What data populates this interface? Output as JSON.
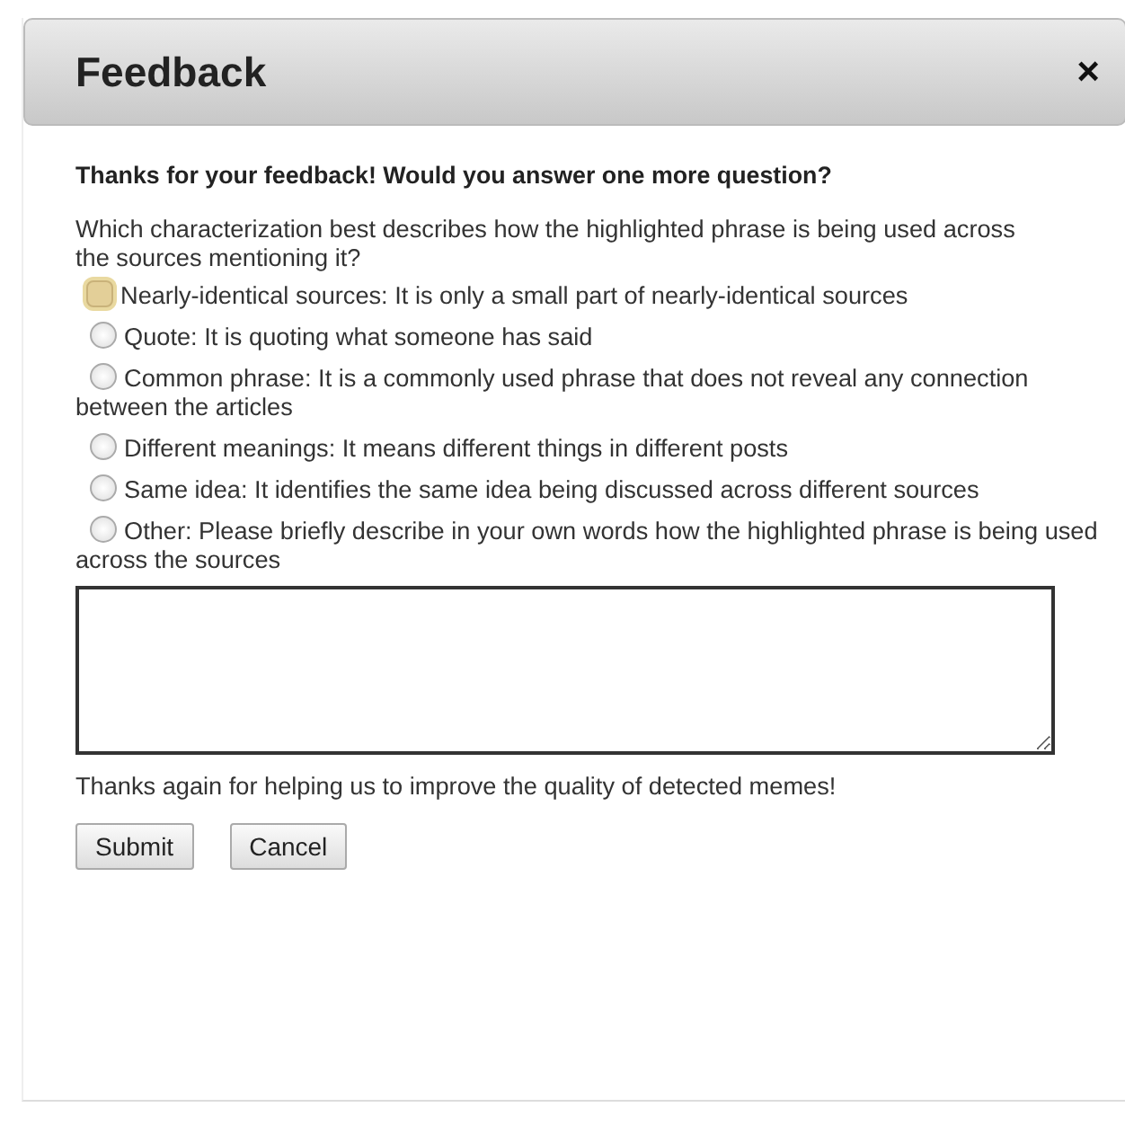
{
  "window": {
    "title": "Feedback",
    "close": "×"
  },
  "heading": "Thanks for your feedback! Would you answer one more question?",
  "question": "Which characterization best describes how the highlighted phrase is being used across the sources mentioning it?",
  "options": [
    {
      "label": "Nearly-identical sources: It is only a small part of nearly-identical sources",
      "selected": false,
      "focused": true
    },
    {
      "label": "Quote: It is quoting what someone has said",
      "selected": false,
      "focused": false
    },
    {
      "label": "Common phrase: It is a commonly used phrase that does not reveal any connection between the articles",
      "selected": false,
      "focused": false
    },
    {
      "label": "Different meanings: It means different things in different posts",
      "selected": false,
      "focused": false
    },
    {
      "label": "Same idea: It identifies the same idea being discussed across different sources",
      "selected": false,
      "focused": false
    },
    {
      "label": "Other: Please briefly describe in your own words how the highlighted phrase is being used across the sources",
      "selected": false,
      "focused": false
    }
  ],
  "footer": "Thanks again for helping us to improve the quality of detected memes!",
  "buttons": [
    "Submit",
    "Cancel"
  ]
}
